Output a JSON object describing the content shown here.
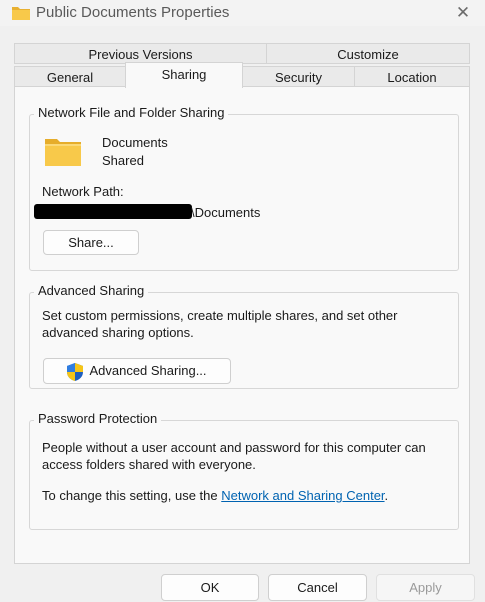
{
  "window": {
    "title": "Public Documents Properties"
  },
  "tabs": {
    "row1": [
      "Previous Versions",
      "Customize"
    ],
    "row2": [
      "General",
      "Sharing",
      "Security",
      "Location"
    ],
    "active": "Sharing"
  },
  "network_sharing": {
    "heading": "Network File and Folder Sharing",
    "folder_name": "Documents",
    "folder_state": "Shared",
    "path_label": "Network Path:",
    "path_suffix": "\\Documents",
    "share_button": "Share..."
  },
  "advanced_sharing": {
    "heading": "Advanced Sharing",
    "description_line1": "Set custom permissions, create multiple shares, and set other",
    "description_line2": "advanced sharing options.",
    "button": "Advanced Sharing..."
  },
  "password_protection": {
    "heading": "Password Protection",
    "line1": "People without a user account and password for this computer can",
    "line2": "access folders shared with everyone.",
    "change_prefix": "To change this setting, use the ",
    "link": "Network and Sharing Center",
    "change_suffix": "."
  },
  "footer": {
    "ok": "OK",
    "cancel": "Cancel",
    "apply": "Apply"
  },
  "icons": {
    "title_folder": "folder-icon",
    "close": "close-icon",
    "documents_folder": "folder-icon",
    "shield": "shield-icon"
  },
  "colors": {
    "link": "#0063b1",
    "folder": "#f8c94a"
  }
}
